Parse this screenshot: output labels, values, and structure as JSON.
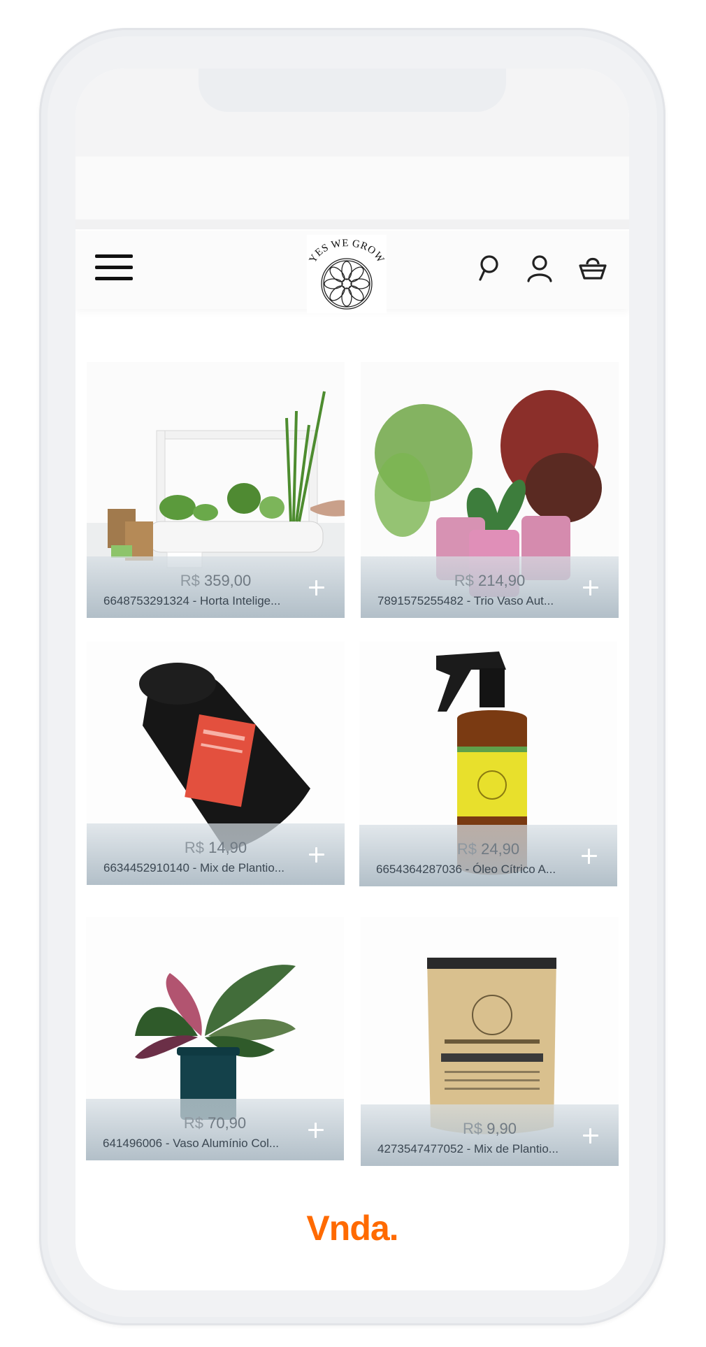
{
  "header": {
    "logo_text": "YES WE GROW",
    "menu_icon": "hamburger-menu-icon",
    "search_icon": "search-icon",
    "account_icon": "user-account-icon",
    "cart_icon": "shopping-basket-icon"
  },
  "products": [
    {
      "price": "359,00",
      "currency": "R$",
      "title": "6648753291324 - Horta Intelige...",
      "image": "smart-garden-kit"
    },
    {
      "price": "214,90",
      "currency": "R$",
      "title": "7891575255482 - Trio Vaso Aut...",
      "image": "trio-pink-pots"
    },
    {
      "price": "14,90",
      "currency": "R$",
      "title": "6634452910140 - Mix de Plantio...",
      "image": "black-soil-bag"
    },
    {
      "price": "24,90",
      "currency": "R$",
      "title": "6654364287036 - Óleo Cítrico A...",
      "image": "citrus-oil-spray"
    },
    {
      "price": "70,90",
      "currency": "R$",
      "title": "641496006 - Vaso Alumínio Col...",
      "image": "plant-green-pot"
    },
    {
      "price": "9,90",
      "currency": "R$",
      "title": "4273547477052 - Mix de Plantio...",
      "image": "kraft-soil-bag"
    }
  ],
  "footer": {
    "brand": "Vnda."
  },
  "colors": {
    "brand_orange": "#ff6a00",
    "overlay": "#b6c2cb"
  }
}
